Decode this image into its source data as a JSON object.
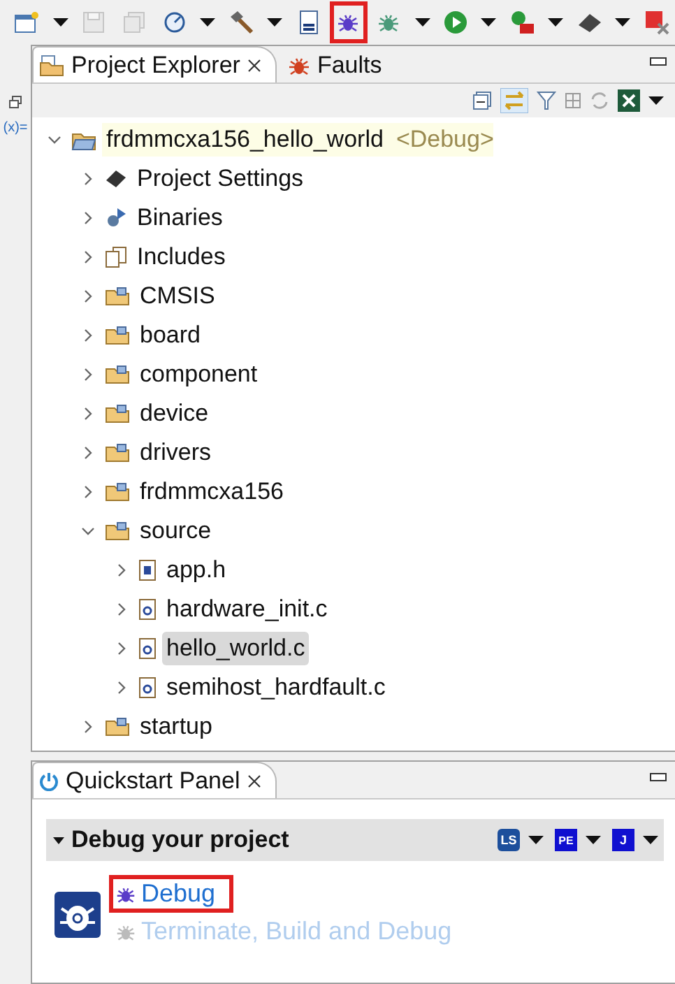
{
  "toolbar": [
    {
      "kind": "new",
      "dropdown": true,
      "disabled": false,
      "highlighted": false
    },
    {
      "kind": "save",
      "dropdown": false,
      "disabled": true,
      "highlighted": false
    },
    {
      "kind": "save_all",
      "dropdown": false,
      "disabled": true,
      "highlighted": false
    },
    {
      "kind": "gauge",
      "dropdown": true,
      "disabled": false,
      "highlighted": false
    },
    {
      "kind": "hammer",
      "dropdown": true,
      "disabled": false,
      "highlighted": false
    },
    {
      "kind": "binary",
      "dropdown": false,
      "disabled": false,
      "highlighted": false
    },
    {
      "kind": "debug",
      "dropdown": false,
      "disabled": false,
      "highlighted": true
    },
    {
      "kind": "bug_green",
      "dropdown": true,
      "disabled": false,
      "highlighted": false
    },
    {
      "kind": "run",
      "dropdown": true,
      "disabled": false,
      "highlighted": false
    },
    {
      "kind": "run_external",
      "dropdown": true,
      "disabled": false,
      "highlighted": false
    },
    {
      "kind": "chip",
      "dropdown": true,
      "disabled": false,
      "highlighted": false
    },
    {
      "kind": "terminate",
      "dropdown": false,
      "disabled": false,
      "highlighted": false
    }
  ],
  "side_strip": {
    "label": "(x)="
  },
  "explorer": {
    "tabs": [
      {
        "label": "Project Explorer",
        "kind": "explorer",
        "selected": true,
        "closable": true
      },
      {
        "label": "Faults",
        "kind": "faults",
        "selected": false,
        "closable": false
      }
    ],
    "tree": [
      {
        "label": "frdmmcxa156_hello_world",
        "suffix": "<Debug>",
        "kind": "project",
        "expanded": true,
        "selected": false,
        "children": [
          {
            "label": "Project Settings",
            "kind": "settings",
            "expanded": false,
            "selected": false
          },
          {
            "label": "Binaries",
            "kind": "binaries",
            "expanded": false,
            "selected": false
          },
          {
            "label": "Includes",
            "kind": "includes",
            "expanded": false,
            "selected": false
          },
          {
            "label": "CMSIS",
            "kind": "folder",
            "expanded": false,
            "selected": false
          },
          {
            "label": "board",
            "kind": "folder",
            "expanded": false,
            "selected": false
          },
          {
            "label": "component",
            "kind": "folder",
            "expanded": false,
            "selected": false
          },
          {
            "label": "device",
            "kind": "folder",
            "expanded": false,
            "selected": false
          },
          {
            "label": "drivers",
            "kind": "folder",
            "expanded": false,
            "selected": false
          },
          {
            "label": "frdmmcxa156",
            "kind": "folder",
            "expanded": false,
            "selected": false
          },
          {
            "label": "source",
            "kind": "folder",
            "expanded": true,
            "selected": false,
            "children": [
              {
                "label": "app.h",
                "kind": "header",
                "expanded": false,
                "selected": false
              },
              {
                "label": "hardware_init.c",
                "kind": "csource",
                "expanded": false,
                "selected": false
              },
              {
                "label": "hello_world.c",
                "kind": "csource",
                "expanded": false,
                "selected": true
              },
              {
                "label": "semihost_hardfault.c",
                "kind": "csource",
                "expanded": false,
                "selected": false
              }
            ]
          },
          {
            "label": "startup",
            "kind": "folder",
            "expanded": false,
            "selected": false
          }
        ]
      }
    ]
  },
  "quickstart": {
    "tab": {
      "label": "Quickstart Panel",
      "selected": true,
      "closable": true
    },
    "section": {
      "title": "Debug your project",
      "expanded": true,
      "probes": [
        "LS",
        "PE",
        "J"
      ]
    },
    "actions": [
      {
        "label": "Debug",
        "disabled": false,
        "highlighted": true
      },
      {
        "label": "Terminate, Build and Debug",
        "disabled": true,
        "highlighted": false
      }
    ]
  }
}
